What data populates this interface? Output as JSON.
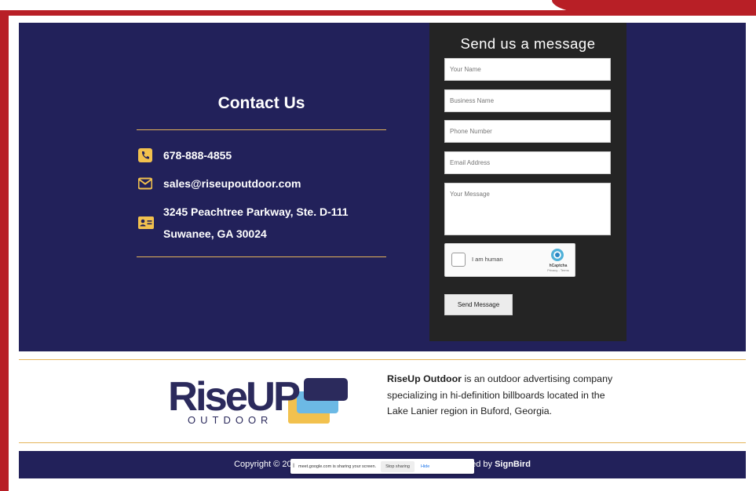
{
  "contact": {
    "title": "Contact Us",
    "phone": "678-888-4855",
    "email": "sales@riseupoutdoor.com",
    "address_line1": "3245 Peachtree Parkway, Ste. D-111",
    "address_line2": "Suwanee, GA 30024",
    "icons": [
      "phone-icon",
      "envelope-icon",
      "address-card-icon"
    ]
  },
  "form": {
    "title": "Send us a message",
    "name_placeholder": "Your Name",
    "business_placeholder": "Business Name",
    "phone_placeholder": "Phone Number",
    "email_placeholder": "Email Address",
    "message_placeholder": "Your Message",
    "captcha_label": "I am human",
    "captcha_brand": "hCaptcha",
    "captcha_links": "Privacy - Terms",
    "submit_label": "Send Message"
  },
  "footer": {
    "logo_text_main": "RiseUP",
    "logo_text_sub": "OUTDOOR",
    "about_brand": "RiseUp Outdoor",
    "about_text": " is an outdoor advertising company specializing in hi-definition billboards located in the Lake Lanier region in Buford, Georgia.",
    "copyright_prefix": "Copyright © 2022 RiseUp Ou",
    "copyright_suffix": "te Powered by ",
    "copyright_brand": "SignBird"
  },
  "share_bar": {
    "message": "meet.google.com is sharing your screen.",
    "stop_label": "Stop sharing",
    "hide_label": "Hide"
  },
  "colors": {
    "accent_red": "#b81f26",
    "navy": "#22215a",
    "gold": "#e5b45a",
    "icon_gold": "#f2c14e",
    "form_bg": "#242424"
  }
}
